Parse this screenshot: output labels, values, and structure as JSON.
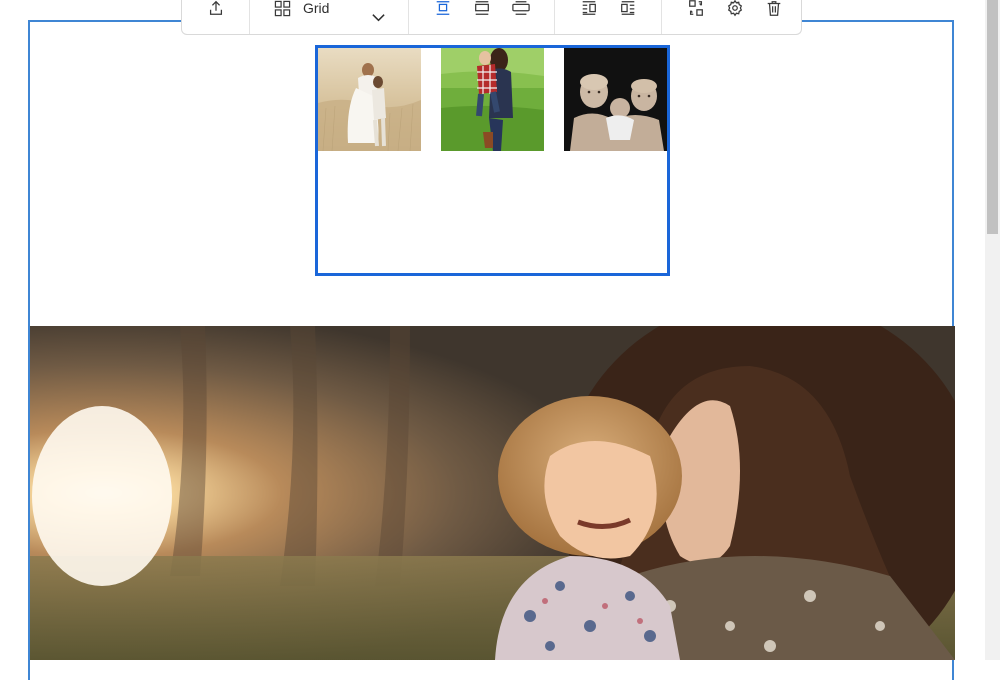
{
  "toolbar": {
    "layout_select": {
      "label": "Grid",
      "icon": "grid-icon"
    },
    "buttons": [
      {
        "name": "upload-icon"
      },
      {
        "name": "align-default-icon",
        "active": true
      },
      {
        "name": "align-wide-icon"
      },
      {
        "name": "align-full-icon"
      },
      {
        "name": "align-left-icon"
      },
      {
        "name": "align-right-icon"
      },
      {
        "name": "replace-icon"
      },
      {
        "name": "settings-gear-icon"
      },
      {
        "name": "trash-icon"
      }
    ],
    "active_color": "#1a66d9"
  },
  "gallery": {
    "items": [
      {
        "name": "wedding-couple-photo"
      },
      {
        "name": "mother-child-field-photo"
      },
      {
        "name": "three-children-photo"
      }
    ],
    "selected_border": "#1a66d9"
  },
  "hero_image": {
    "name": "mother-daughter-sunset-photo"
  },
  "colors": {
    "block_border": "#3f86d4"
  }
}
